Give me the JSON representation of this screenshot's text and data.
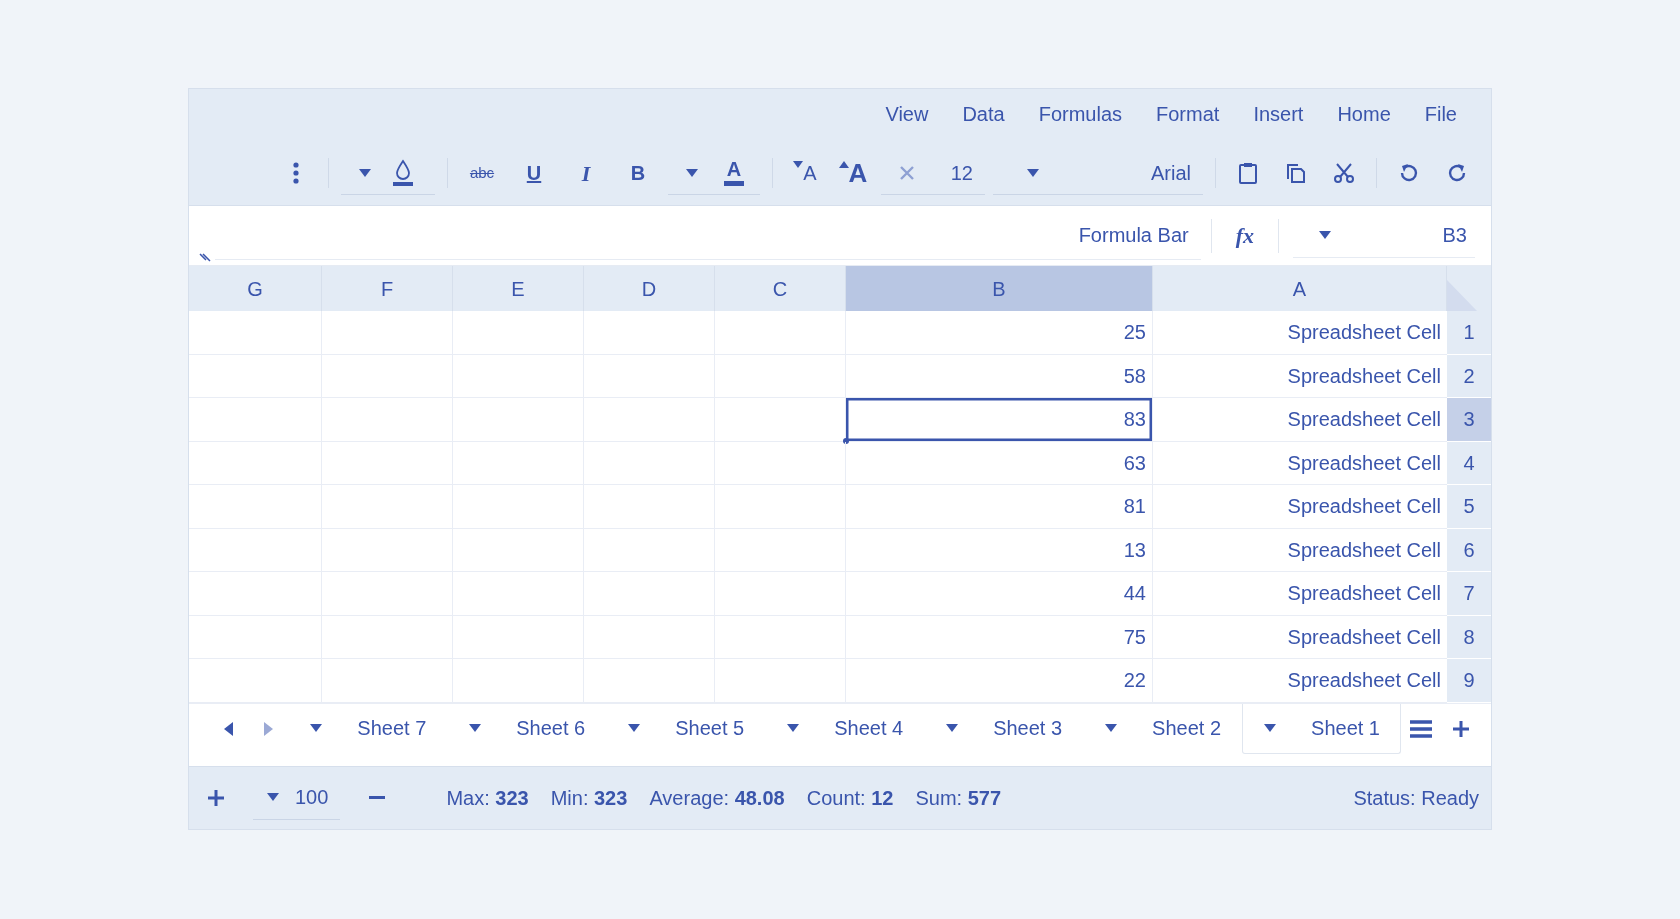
{
  "menu": [
    {
      "label": "View"
    },
    {
      "label": "Data"
    },
    {
      "label": "Formulas"
    },
    {
      "label": "Format"
    },
    {
      "label": "Insert"
    },
    {
      "label": "Home"
    },
    {
      "label": "File"
    }
  ],
  "toolbar": {
    "font": "Arial",
    "font_size": "12",
    "size_buttons": [
      {
        "kind": "decrease",
        "label": "A"
      },
      {
        "kind": "increase",
        "label": "A"
      }
    ],
    "font_color": "A",
    "format_buttons": [
      {
        "kind": "strike",
        "label": "abc"
      },
      {
        "kind": "underline",
        "label": "U"
      },
      {
        "kind": "italic",
        "label": "I"
      },
      {
        "kind": "bold",
        "label": "B"
      }
    ]
  },
  "formula_bar": {
    "name_box": "B3",
    "function_label": "fx",
    "placeholder": "Formula Bar"
  },
  "grid": {
    "columns": [
      {
        "label": "G",
        "selected": false
      },
      {
        "label": "F",
        "selected": false
      },
      {
        "label": "E",
        "selected": false
      },
      {
        "label": "D",
        "selected": false
      },
      {
        "label": "C",
        "selected": false
      },
      {
        "label": "B",
        "selected": true
      },
      {
        "label": "A",
        "selected": false
      }
    ],
    "rows": [
      {
        "number": "1",
        "selected": false,
        "cells": [
          {
            "text": "25",
            "selected": false
          },
          {
            "text": "Spreadsheet Cell",
            "selected": false
          }
        ]
      },
      {
        "number": "2",
        "selected": false,
        "cells": [
          {
            "text": "58",
            "selected": false
          },
          {
            "text": "Spreadsheet Cell",
            "selected": false
          }
        ]
      },
      {
        "number": "3",
        "selected": true,
        "cells": [
          {
            "text": "83",
            "selected": true
          },
          {
            "text": "Spreadsheet Cell",
            "selected": false
          }
        ]
      },
      {
        "number": "4",
        "selected": false,
        "cells": [
          {
            "text": "63",
            "selected": false
          },
          {
            "text": "Spreadsheet Cell",
            "selected": false
          }
        ]
      },
      {
        "number": "5",
        "selected": false,
        "cells": [
          {
            "text": "81",
            "selected": false
          },
          {
            "text": "Spreadsheet Cell",
            "selected": false
          }
        ]
      },
      {
        "number": "6",
        "selected": false,
        "cells": [
          {
            "text": "13",
            "selected": false
          },
          {
            "text": "Spreadsheet Cell",
            "selected": false
          }
        ]
      },
      {
        "number": "7",
        "selected": false,
        "cells": [
          {
            "text": "44",
            "selected": false
          },
          {
            "text": "Spreadsheet Cell",
            "selected": false
          }
        ]
      },
      {
        "number": "8",
        "selected": false,
        "cells": [
          {
            "text": "75",
            "selected": false
          },
          {
            "text": "Spreadsheet Cell",
            "selected": false
          }
        ]
      },
      {
        "number": "9",
        "selected": false,
        "cells": [
          {
            "text": "22",
            "selected": false
          },
          {
            "text": "Spreadsheet Cell",
            "selected": false
          }
        ]
      }
    ]
  },
  "sheet_tabs": [
    {
      "label": "Sheet 7",
      "selected": false
    },
    {
      "label": "Sheet 6",
      "selected": false
    },
    {
      "label": "Sheet 5",
      "selected": false
    },
    {
      "label": "Sheet 4",
      "selected": false
    },
    {
      "label": "Sheet 3",
      "selected": false
    },
    {
      "label": "Sheet 2",
      "selected": false
    },
    {
      "label": "Sheet 1",
      "selected": true
    }
  ],
  "sheet_nav": [
    {
      "kind": "prev",
      "disabled": false
    },
    {
      "kind": "next",
      "disabled": true
    }
  ],
  "status_bar": {
    "zoom": "100",
    "stats": [
      "Max: **323**",
      "Min: **323**",
      "Average: **48.08**",
      "Count: **12**",
      "Sum: **577**"
    ],
    "status": "Status: Ready"
  }
}
